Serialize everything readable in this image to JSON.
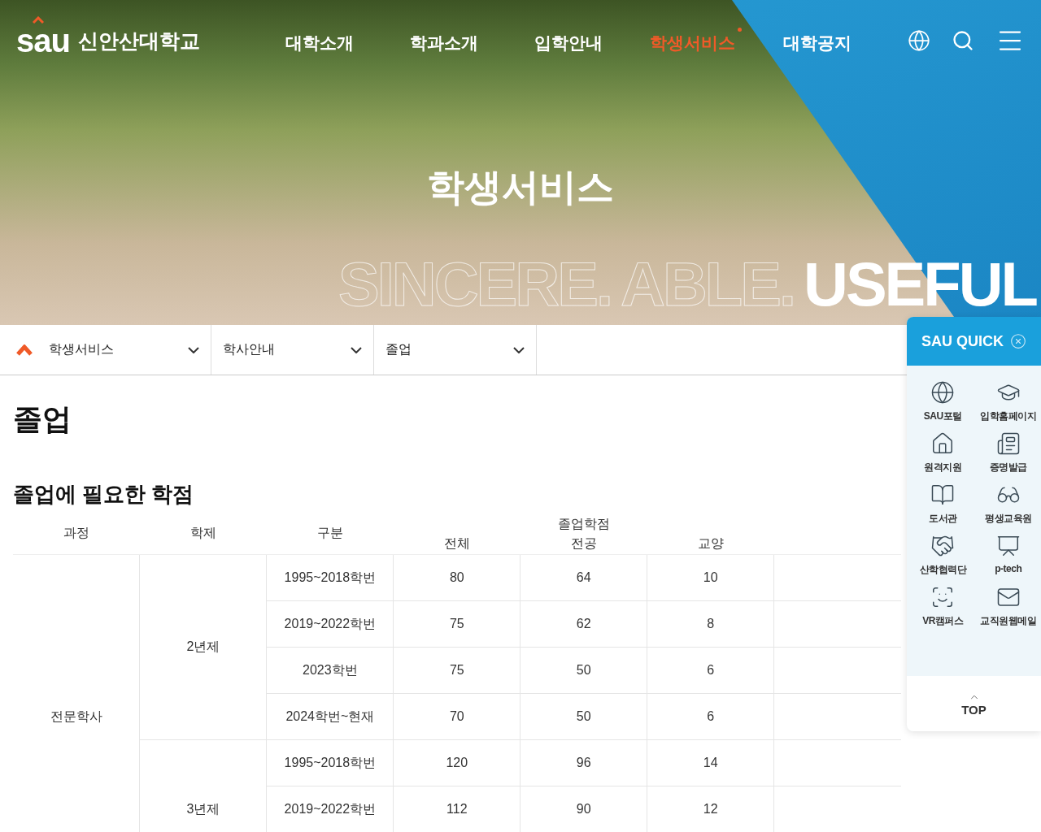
{
  "header": {
    "logo_mark": "sau",
    "logo_text": "신안산대학교",
    "nav": [
      {
        "label": "대학소개",
        "selected": false
      },
      {
        "label": "학과소개",
        "selected": false
      },
      {
        "label": "입학안내",
        "selected": false
      },
      {
        "label": "학생서비스",
        "selected": true
      },
      {
        "label": "대학공지",
        "selected": false
      }
    ]
  },
  "hero": {
    "title": "학생서비스",
    "tagline": [
      {
        "text": "SINCERE.",
        "outlined": true
      },
      {
        "text": "ABLE.",
        "outlined": true
      },
      {
        "text": "USEFUL",
        "outlined": false
      }
    ]
  },
  "breadcrumb": [
    "학생서비스",
    "학사안내",
    "졸업"
  ],
  "page_title": "졸업",
  "section_title": "졸업에 필요한 학점",
  "table": {
    "columns": [
      "과정",
      "학제",
      "구분"
    ],
    "group_header": "졸업학점",
    "sub_columns": [
      "전체",
      "전공",
      "교양"
    ],
    "programs": [
      {
        "name": "전문학사",
        "terms": [
          {
            "name": "2년제",
            "rows": [
              [
                "1995~2018학번",
                "80",
                "64",
                "10"
              ],
              [
                "2019~2022학번",
                "75",
                "62",
                "8"
              ],
              [
                "2023학번",
                "75",
                "50",
                "6"
              ],
              [
                "2024학번~현재",
                "70",
                "50",
                "6"
              ]
            ]
          },
          {
            "name": "3년제",
            "rows": [
              [
                "1995~2018학번",
                "120",
                "96",
                "14"
              ],
              [
                "2019~2022학번",
                "112",
                "90",
                "12"
              ]
            ]
          }
        ]
      }
    ]
  },
  "quick": {
    "title": "SAU QUICK",
    "items": [
      {
        "label": "SAU포털",
        "kind": "portal"
      },
      {
        "label": "입학홈페이지",
        "kind": "admission"
      },
      {
        "label": "원격지원",
        "kind": "remote"
      },
      {
        "label": "증명발급",
        "kind": "certificate"
      },
      {
        "label": "도서관",
        "kind": "library"
      },
      {
        "label": "평생교육원",
        "kind": "lifelong"
      },
      {
        "label": "산학협력단",
        "kind": "industry"
      },
      {
        "label": "p-tech",
        "kind": "ptech"
      },
      {
        "label": "VR캠퍼스",
        "kind": "vr"
      },
      {
        "label": "교직원웹메일",
        "kind": "mail"
      }
    ],
    "top": "TOP"
  }
}
